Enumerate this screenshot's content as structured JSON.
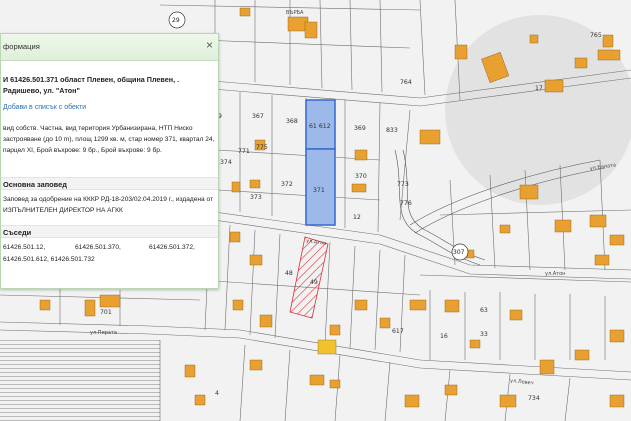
{
  "panel": {
    "header": "формация",
    "close_glyph": "×",
    "title": "И 61426.501.371 област Плевен, община Плевен, . Радишево, ул. \"Атон\"",
    "add_link": "Добави в списък с обекти",
    "description": "вид собств. Частна, вид територия Урбанизирана, НТП Ниско застрояване (до 10 m), площ 1299 кв. м, стар номер 371, квартал 24, парцел XI, Брой въхрове: 9 бр., Брой въхрове: 9 бр.",
    "order_heading": "Основна заповед",
    "order_text": "Заповед за одобрение на КККР РД-18-203/02.04.2019 г., издадена от ИЗПЪЛНИТЕЛЕН ДИРЕКТОР НА АГКК",
    "neighbors_heading": "Съседи",
    "neighbors": [
      "61426.501.12,",
      "61426.501.370,",
      "61426.501.372,",
      "61426.501.612, 61426.501.732"
    ]
  },
  "map": {
    "parcels": [
      "368",
      "367",
      "369",
      "370",
      "372",
      "373",
      "374",
      "49",
      "48",
      "775",
      "771",
      "773",
      "776",
      "12",
      "833",
      "764",
      "765",
      "9",
      "701",
      "734",
      "617",
      "16",
      "63",
      "33",
      "4",
      "17",
      "612",
      "371"
    ],
    "parcel_612": "61 612",
    "selected_parcel": "371",
    "circled": [
      "29",
      "307"
    ],
    "streets": [
      "ул.Атон",
      "ул.Бялата",
      "ул.Ловеч",
      "ул.Пирата"
    ],
    "building_label": "ВЪРБА",
    "colors": {
      "selected": "#9db9e9",
      "building": "#e8a030",
      "panel_header": "#dfefd9",
      "hatch": "#d9303a"
    }
  }
}
